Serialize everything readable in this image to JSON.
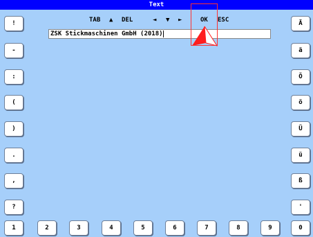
{
  "window": {
    "title": "Text"
  },
  "toolbar": {
    "tab": "TAB",
    "up": "▲",
    "del": "DEL",
    "left": "◄",
    "down": "▼",
    "right": "►",
    "ok": "OK",
    "esc": "ESC"
  },
  "input": {
    "value": "ZSK Stickmaschinen GmbH (2018)"
  },
  "left_keys": [
    "!",
    "-",
    ":",
    "(",
    ")",
    ".",
    ",",
    "?"
  ],
  "right_keys": [
    "Ä",
    "ä",
    "Ö",
    "ö",
    "Ü",
    "ü",
    "ß",
    "'"
  ],
  "bottom_keys": [
    "1",
    "2",
    "3",
    "4",
    "5",
    "6",
    "7",
    "8",
    "9",
    "0"
  ],
  "colors": {
    "background": "#a6cffa",
    "titlebar": "#0000ff",
    "cursor_highlight": "#ff3030"
  }
}
